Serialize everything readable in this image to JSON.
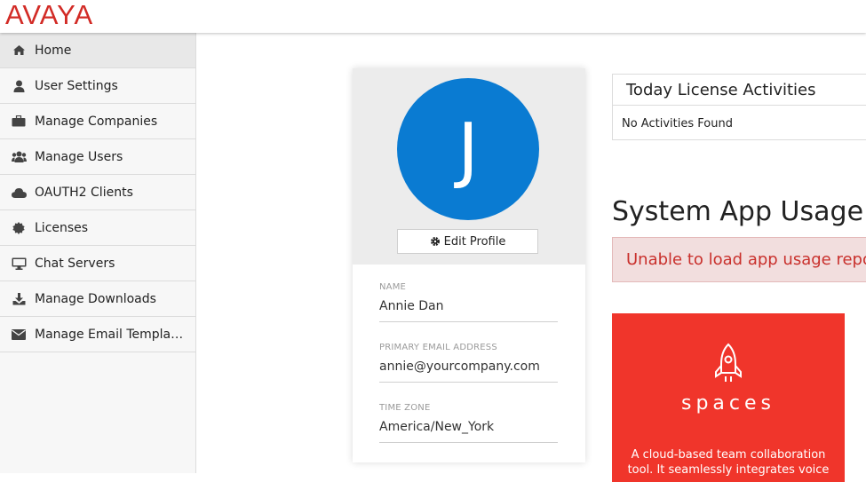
{
  "header": {
    "logo": "AVAYA"
  },
  "sidebar": {
    "items": [
      {
        "label": "Home",
        "icon": "home-icon",
        "active": true
      },
      {
        "label": "User Settings",
        "icon": "user-icon"
      },
      {
        "label": "Manage Companies",
        "icon": "briefcase-icon"
      },
      {
        "label": "Manage Users",
        "icon": "users-icon"
      },
      {
        "label": "OAUTH2 Clients",
        "icon": "cloud-icon"
      },
      {
        "label": "Licenses",
        "icon": "certificate-icon"
      },
      {
        "label": "Chat Servers",
        "icon": "desktop-icon"
      },
      {
        "label": "Manage Downloads",
        "icon": "download-icon"
      },
      {
        "label": "Manage Email Templa…",
        "icon": "envelope-icon"
      }
    ]
  },
  "profile": {
    "avatar_initial": "J",
    "edit_label": "Edit Profile",
    "fields": [
      {
        "label": "NAME",
        "value": "Annie Dan"
      },
      {
        "label": "PRIMARY EMAIL ADDRESS",
        "value": "annie@yourcompany.com"
      },
      {
        "label": "TIME ZONE",
        "value": "America/New_York"
      }
    ]
  },
  "licenses": {
    "title": "Today License Activities",
    "empty": "No Activities Found"
  },
  "app_usage": {
    "title": "System App Usage",
    "error": "Unable to load app usage repo"
  },
  "spaces_card": {
    "word": "spaces",
    "description": "A cloud-based team collaboration tool. It seamlessly integrates voice"
  },
  "colors": {
    "brand_red": "#d22b26",
    "avatar_blue": "#0a7bd2",
    "spaces_red": "#f0352b",
    "alert_bg": "#f2dede"
  }
}
